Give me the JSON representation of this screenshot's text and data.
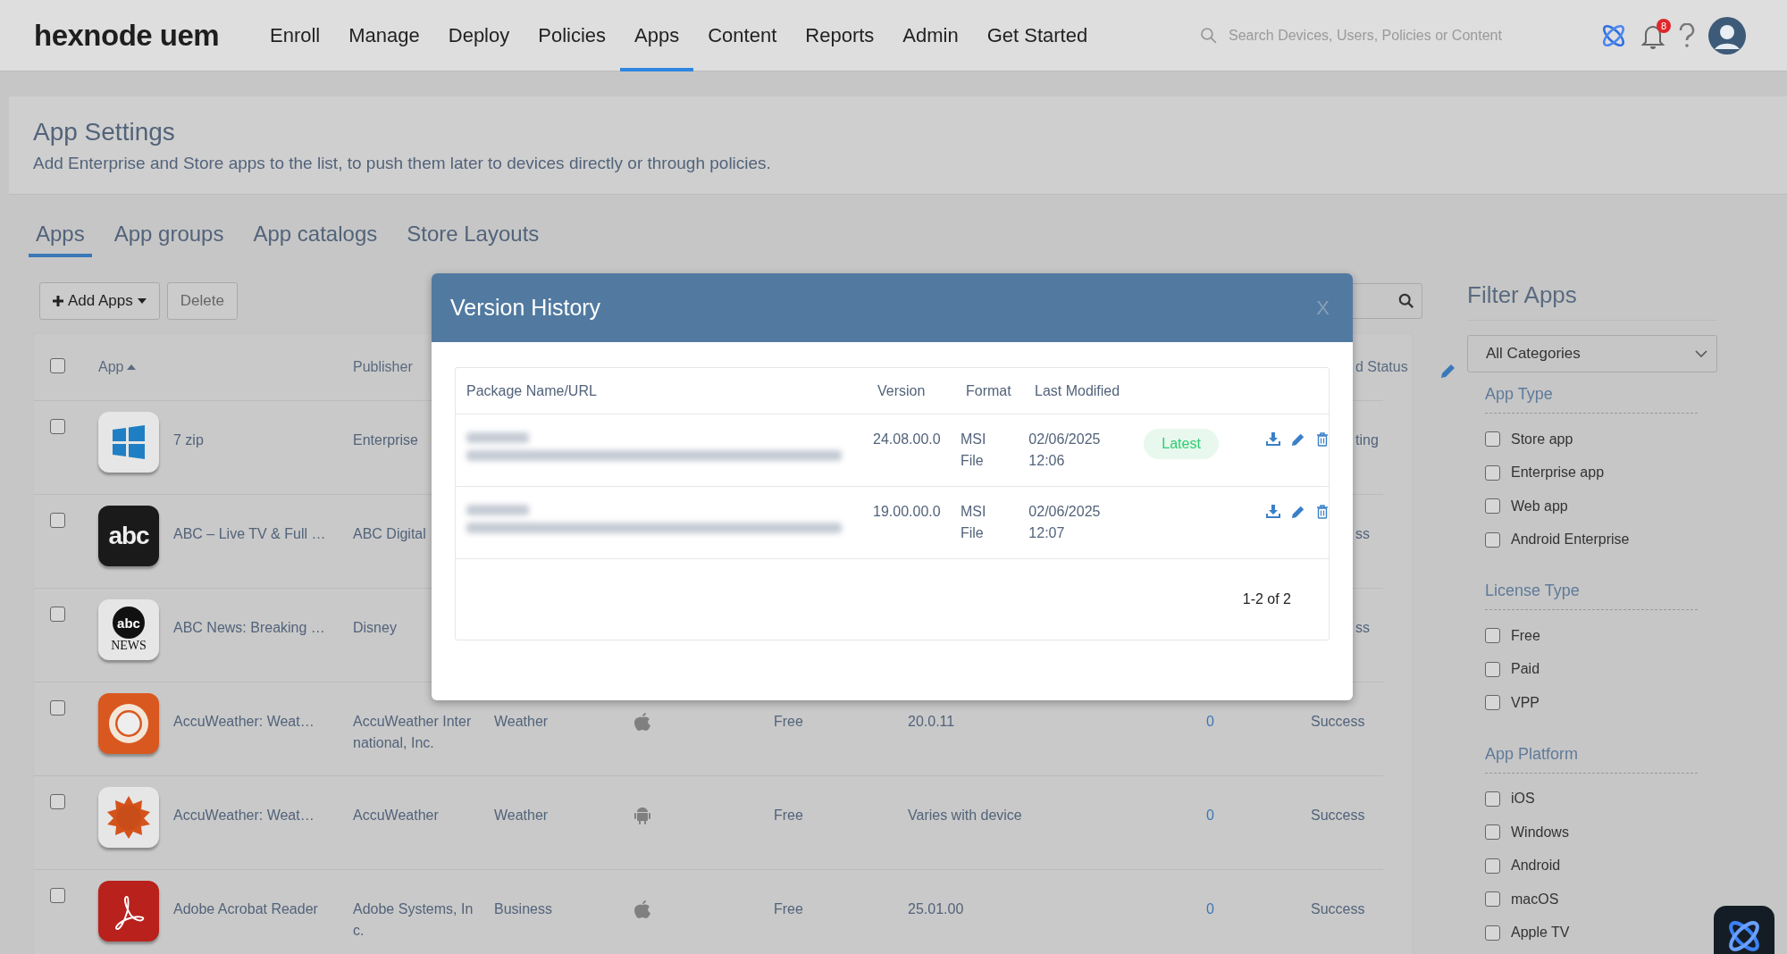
{
  "topbar": {
    "logo": "hexnode uem",
    "nav": [
      {
        "label": "Enroll",
        "selected": false
      },
      {
        "label": "Manage",
        "selected": false
      },
      {
        "label": "Deploy",
        "selected": false
      },
      {
        "label": "Policies",
        "selected": false
      },
      {
        "label": "Apps",
        "selected": true
      },
      {
        "label": "Content",
        "selected": false
      },
      {
        "label": "Reports",
        "selected": false
      },
      {
        "label": "Admin",
        "selected": false
      },
      {
        "label": "Get Started",
        "selected": false
      }
    ],
    "search": {
      "placeholder": "Search Devices, Users, Policies or Content"
    },
    "notifications": "8"
  },
  "page": {
    "title": "App Settings",
    "subtitle": "Add Enterprise and Store apps to the list, to push them later to devices directly or through policies."
  },
  "tabs": [
    {
      "label": "Apps",
      "selected": true
    },
    {
      "label": "App groups",
      "selected": false
    },
    {
      "label": "App catalogs",
      "selected": false
    },
    {
      "label": "Store Layouts",
      "selected": false
    }
  ],
  "toolbar": {
    "add_button": "Add Apps",
    "delete_button": "Delete"
  },
  "table": {
    "select_all": {
      "checked": false
    },
    "columns": [
      {
        "label": "App"
      },
      {
        "label": "Publisher"
      },
      {
        "label": "d Status"
      }
    ],
    "rows": [
      {
        "checked": false,
        "icon": {
          "kind": "windows"
        },
        "name": "7 zip",
        "publisher": "Enterprise",
        "status": "ting"
      },
      {
        "checked": false,
        "icon": {
          "kind": "abc",
          "text": "abc"
        },
        "name": "ABC – Live TV & Full …",
        "publisher": "ABC Digital",
        "status": "ss"
      },
      {
        "checked": false,
        "icon": {
          "kind": "abcnews",
          "text": "abc",
          "caption": "NEWS"
        },
        "name": "ABC News: Breaking …",
        "publisher": "Disney",
        "status": "ss"
      },
      {
        "checked": false,
        "icon": {
          "kind": "sunring"
        },
        "name": "AccuWeather: Weat…",
        "publisher": "AccuWeather International, Inc.",
        "category": "Weather",
        "platform": {
          "kind": "apple"
        },
        "license": "Free",
        "version": "20.0.11",
        "installs": "0",
        "status": "Success"
      },
      {
        "checked": false,
        "icon": {
          "kind": "sun"
        },
        "name": "AccuWeather: Weat…",
        "publisher": "AccuWeather",
        "category": "Weather",
        "platform": {
          "kind": "android"
        },
        "license": "Free",
        "version": "Varies with device",
        "installs": "0",
        "status": "Success"
      },
      {
        "checked": false,
        "icon": {
          "kind": "acrobat"
        },
        "name": "Adobe Acrobat Reader",
        "publisher": "Adobe Systems, Inc.",
        "category": "Business",
        "platform": {
          "kind": "apple"
        },
        "license": "Free",
        "version": "25.01.00",
        "installs": "0",
        "status": "Success"
      }
    ]
  },
  "modal": {
    "title": "Version History",
    "close": "X",
    "columns": [
      "Package Name/URL",
      "Version",
      "Format",
      "Last Modified"
    ],
    "rows": [
      {
        "package_blurred": true,
        "version": "24.08.00.0",
        "format": "MSI File",
        "modified": "02/06/2025 12:06",
        "badge": "Latest"
      },
      {
        "package_blurred": true,
        "version": "19.00.00.0",
        "format": "MSI File",
        "modified": "02/06/2025 12:07"
      }
    ],
    "pagination": "1-2 of 2"
  },
  "filters": {
    "title": "Filter Apps",
    "category": "All Categories",
    "groups": [
      {
        "title": "App Type",
        "options": [
          {
            "label": "Store app",
            "checked": false
          },
          {
            "label": "Enterprise app",
            "checked": false
          },
          {
            "label": "Web app",
            "checked": false
          },
          {
            "label": "Android Enterprise",
            "checked": false
          }
        ]
      },
      {
        "title": "License Type",
        "options": [
          {
            "label": "Free",
            "checked": false
          },
          {
            "label": "Paid",
            "checked": false
          },
          {
            "label": "VPP",
            "checked": false
          }
        ]
      },
      {
        "title": "App Platform",
        "options": [
          {
            "label": "iOS",
            "checked": false
          },
          {
            "label": "Windows",
            "checked": false
          },
          {
            "label": "Android",
            "checked": false
          },
          {
            "label": "macOS",
            "checked": false
          },
          {
            "label": "Apple TV",
            "checked": false
          }
        ]
      }
    ]
  }
}
